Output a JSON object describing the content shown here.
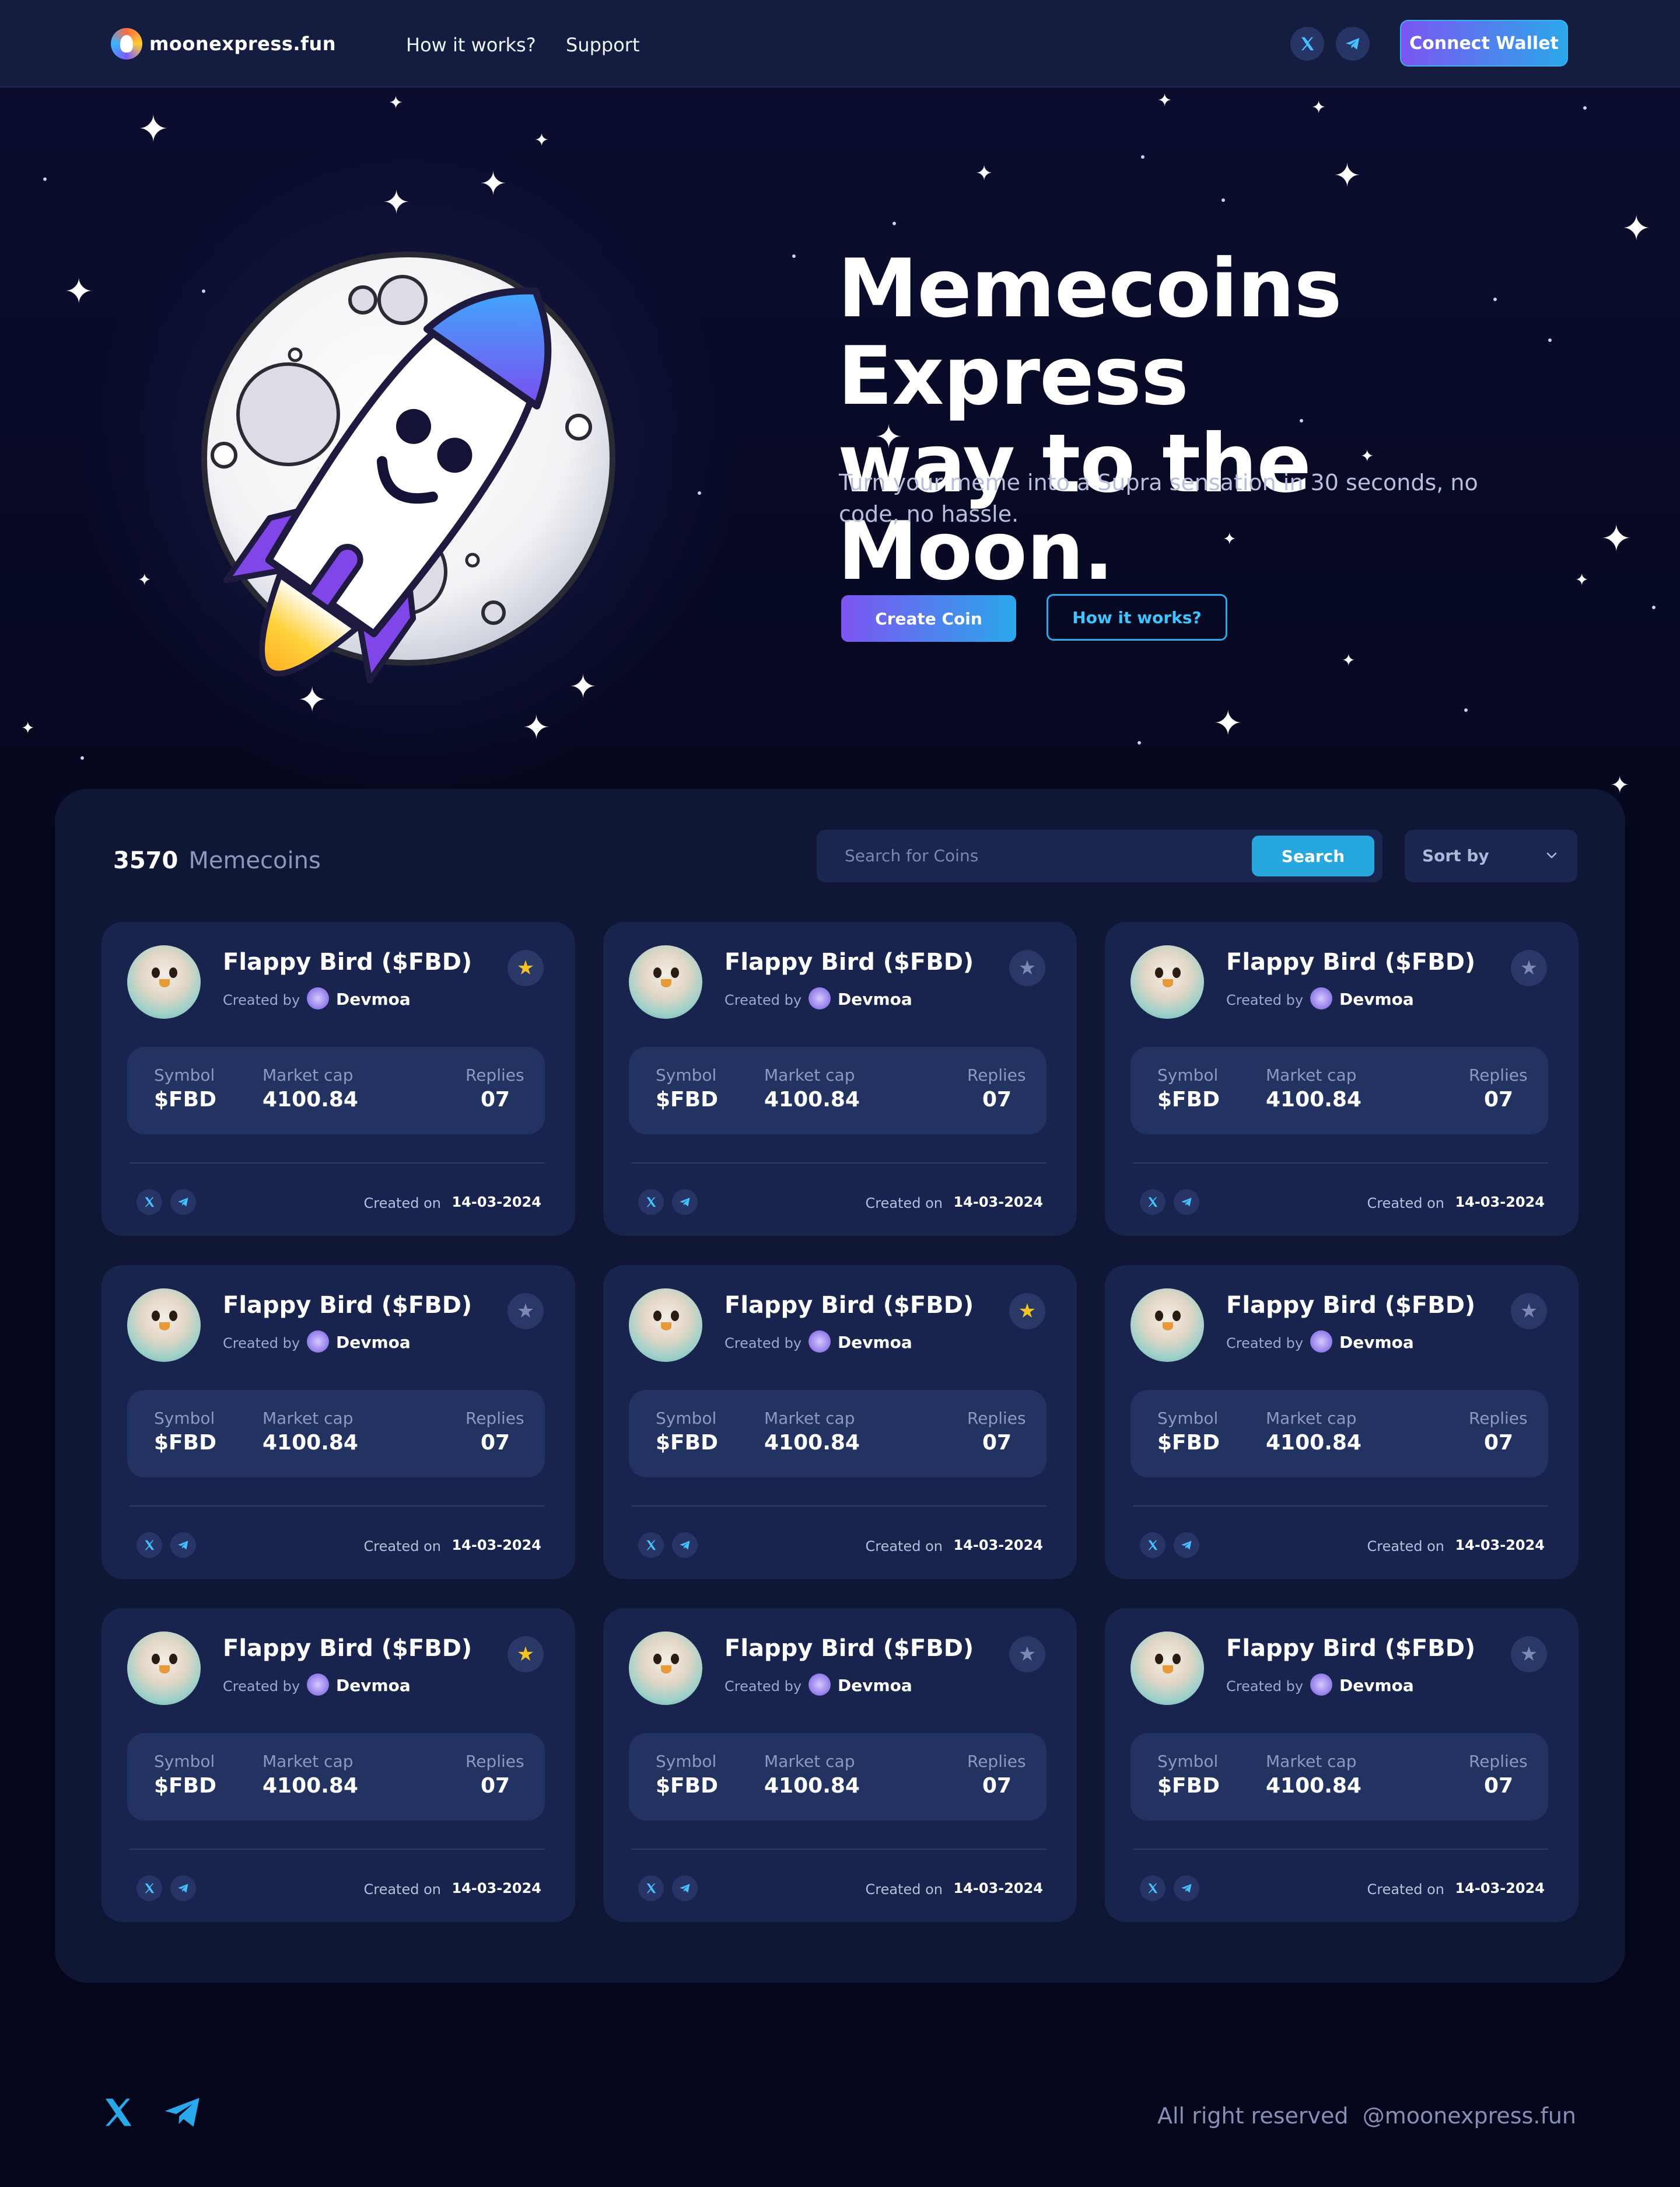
{
  "nav": {
    "brand": "moonexpress.fun",
    "links": [
      "How it works?",
      "Support"
    ],
    "connect_label": "Connect Wallet"
  },
  "hero": {
    "title_line1": "Memecoins Express",
    "title_line2": "way to the Moon.",
    "subtitle": "Turn your meme into a Supra sensation in 30 seconds, no code, no hassle.",
    "create_label": "Create Coin",
    "how_label": "How it works?"
  },
  "listing": {
    "count": "3570",
    "count_label": "Memecoins",
    "search_placeholder": "Search for Coins",
    "search_button": "Search",
    "sort_label": "Sort by"
  },
  "card_labels": {
    "created_by": "Created by",
    "symbol": "Symbol",
    "market_cap": "Market cap",
    "replies": "Replies",
    "created_on": "Created on"
  },
  "coins": [
    {
      "name": "Flappy Bird ($FBD)",
      "creator": "Devmoa",
      "symbol": "$FBD",
      "market_cap": "4100.84",
      "replies": "07",
      "date": "14-03-2024",
      "favorite": true
    },
    {
      "name": "Flappy Bird ($FBD)",
      "creator": "Devmoa",
      "symbol": "$FBD",
      "market_cap": "4100.84",
      "replies": "07",
      "date": "14-03-2024",
      "favorite": false
    },
    {
      "name": "Flappy Bird ($FBD)",
      "creator": "Devmoa",
      "symbol": "$FBD",
      "market_cap": "4100.84",
      "replies": "07",
      "date": "14-03-2024",
      "favorite": false
    },
    {
      "name": "Flappy Bird ($FBD)",
      "creator": "Devmoa",
      "symbol": "$FBD",
      "market_cap": "4100.84",
      "replies": "07",
      "date": "14-03-2024",
      "favorite": false
    },
    {
      "name": "Flappy Bird ($FBD)",
      "creator": "Devmoa",
      "symbol": "$FBD",
      "market_cap": "4100.84",
      "replies": "07",
      "date": "14-03-2024",
      "favorite": true
    },
    {
      "name": "Flappy Bird ($FBD)",
      "creator": "Devmoa",
      "symbol": "$FBD",
      "market_cap": "4100.84",
      "replies": "07",
      "date": "14-03-2024",
      "favorite": false
    },
    {
      "name": "Flappy Bird ($FBD)",
      "creator": "Devmoa",
      "symbol": "$FBD",
      "market_cap": "4100.84",
      "replies": "07",
      "date": "14-03-2024",
      "favorite": true
    },
    {
      "name": "Flappy Bird ($FBD)",
      "creator": "Devmoa",
      "symbol": "$FBD",
      "market_cap": "4100.84",
      "replies": "07",
      "date": "14-03-2024",
      "favorite": false
    },
    {
      "name": "Flappy Bird ($FBD)",
      "creator": "Devmoa",
      "symbol": "$FBD",
      "market_cap": "4100.84",
      "replies": "07",
      "date": "14-03-2024",
      "favorite": false
    }
  ],
  "footer": {
    "rights": "All right reserved",
    "handle": "@moonexpress.fun"
  },
  "colors": {
    "background": "#04061c",
    "nav": "#141d3f",
    "card": "#18244d",
    "accent_purple": "#7c55f2",
    "accent_blue": "#2aa8ea",
    "favorite_on": "#f5c321"
  },
  "icons": [
    "x-icon",
    "telegram-icon",
    "star-icon",
    "chevron-down-icon",
    "rocket-moon-illustration"
  ]
}
